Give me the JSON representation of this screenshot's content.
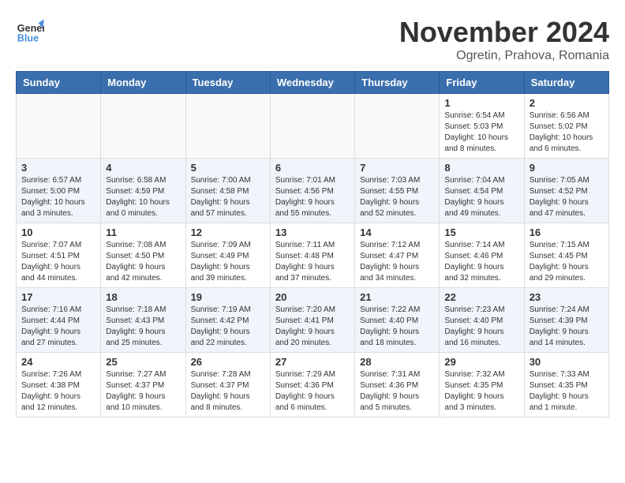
{
  "header": {
    "logo_general": "General",
    "logo_blue": "Blue",
    "month_title": "November 2024",
    "location": "Ogretin, Prahova, Romania"
  },
  "weekdays": [
    "Sunday",
    "Monday",
    "Tuesday",
    "Wednesday",
    "Thursday",
    "Friday",
    "Saturday"
  ],
  "weeks": [
    [
      {
        "day": "",
        "info": ""
      },
      {
        "day": "",
        "info": ""
      },
      {
        "day": "",
        "info": ""
      },
      {
        "day": "",
        "info": ""
      },
      {
        "day": "",
        "info": ""
      },
      {
        "day": "1",
        "info": "Sunrise: 6:54 AM\nSunset: 5:03 PM\nDaylight: 10 hours and 8 minutes."
      },
      {
        "day": "2",
        "info": "Sunrise: 6:56 AM\nSunset: 5:02 PM\nDaylight: 10 hours and 6 minutes."
      }
    ],
    [
      {
        "day": "3",
        "info": "Sunrise: 6:57 AM\nSunset: 5:00 PM\nDaylight: 10 hours and 3 minutes."
      },
      {
        "day": "4",
        "info": "Sunrise: 6:58 AM\nSunset: 4:59 PM\nDaylight: 10 hours and 0 minutes."
      },
      {
        "day": "5",
        "info": "Sunrise: 7:00 AM\nSunset: 4:58 PM\nDaylight: 9 hours and 57 minutes."
      },
      {
        "day": "6",
        "info": "Sunrise: 7:01 AM\nSunset: 4:56 PM\nDaylight: 9 hours and 55 minutes."
      },
      {
        "day": "7",
        "info": "Sunrise: 7:03 AM\nSunset: 4:55 PM\nDaylight: 9 hours and 52 minutes."
      },
      {
        "day": "8",
        "info": "Sunrise: 7:04 AM\nSunset: 4:54 PM\nDaylight: 9 hours and 49 minutes."
      },
      {
        "day": "9",
        "info": "Sunrise: 7:05 AM\nSunset: 4:52 PM\nDaylight: 9 hours and 47 minutes."
      }
    ],
    [
      {
        "day": "10",
        "info": "Sunrise: 7:07 AM\nSunset: 4:51 PM\nDaylight: 9 hours and 44 minutes."
      },
      {
        "day": "11",
        "info": "Sunrise: 7:08 AM\nSunset: 4:50 PM\nDaylight: 9 hours and 42 minutes."
      },
      {
        "day": "12",
        "info": "Sunrise: 7:09 AM\nSunset: 4:49 PM\nDaylight: 9 hours and 39 minutes."
      },
      {
        "day": "13",
        "info": "Sunrise: 7:11 AM\nSunset: 4:48 PM\nDaylight: 9 hours and 37 minutes."
      },
      {
        "day": "14",
        "info": "Sunrise: 7:12 AM\nSunset: 4:47 PM\nDaylight: 9 hours and 34 minutes."
      },
      {
        "day": "15",
        "info": "Sunrise: 7:14 AM\nSunset: 4:46 PM\nDaylight: 9 hours and 32 minutes."
      },
      {
        "day": "16",
        "info": "Sunrise: 7:15 AM\nSunset: 4:45 PM\nDaylight: 9 hours and 29 minutes."
      }
    ],
    [
      {
        "day": "17",
        "info": "Sunrise: 7:16 AM\nSunset: 4:44 PM\nDaylight: 9 hours and 27 minutes."
      },
      {
        "day": "18",
        "info": "Sunrise: 7:18 AM\nSunset: 4:43 PM\nDaylight: 9 hours and 25 minutes."
      },
      {
        "day": "19",
        "info": "Sunrise: 7:19 AM\nSunset: 4:42 PM\nDaylight: 9 hours and 22 minutes."
      },
      {
        "day": "20",
        "info": "Sunrise: 7:20 AM\nSunset: 4:41 PM\nDaylight: 9 hours and 20 minutes."
      },
      {
        "day": "21",
        "info": "Sunrise: 7:22 AM\nSunset: 4:40 PM\nDaylight: 9 hours and 18 minutes."
      },
      {
        "day": "22",
        "info": "Sunrise: 7:23 AM\nSunset: 4:40 PM\nDaylight: 9 hours and 16 minutes."
      },
      {
        "day": "23",
        "info": "Sunrise: 7:24 AM\nSunset: 4:39 PM\nDaylight: 9 hours and 14 minutes."
      }
    ],
    [
      {
        "day": "24",
        "info": "Sunrise: 7:26 AM\nSunset: 4:38 PM\nDaylight: 9 hours and 12 minutes."
      },
      {
        "day": "25",
        "info": "Sunrise: 7:27 AM\nSunset: 4:37 PM\nDaylight: 9 hours and 10 minutes."
      },
      {
        "day": "26",
        "info": "Sunrise: 7:28 AM\nSunset: 4:37 PM\nDaylight: 9 hours and 8 minutes."
      },
      {
        "day": "27",
        "info": "Sunrise: 7:29 AM\nSunset: 4:36 PM\nDaylight: 9 hours and 6 minutes."
      },
      {
        "day": "28",
        "info": "Sunrise: 7:31 AM\nSunset: 4:36 PM\nDaylight: 9 hours and 5 minutes."
      },
      {
        "day": "29",
        "info": "Sunrise: 7:32 AM\nSunset: 4:35 PM\nDaylight: 9 hours and 3 minutes."
      },
      {
        "day": "30",
        "info": "Sunrise: 7:33 AM\nSunset: 4:35 PM\nDaylight: 9 hours and 1 minute."
      }
    ]
  ]
}
